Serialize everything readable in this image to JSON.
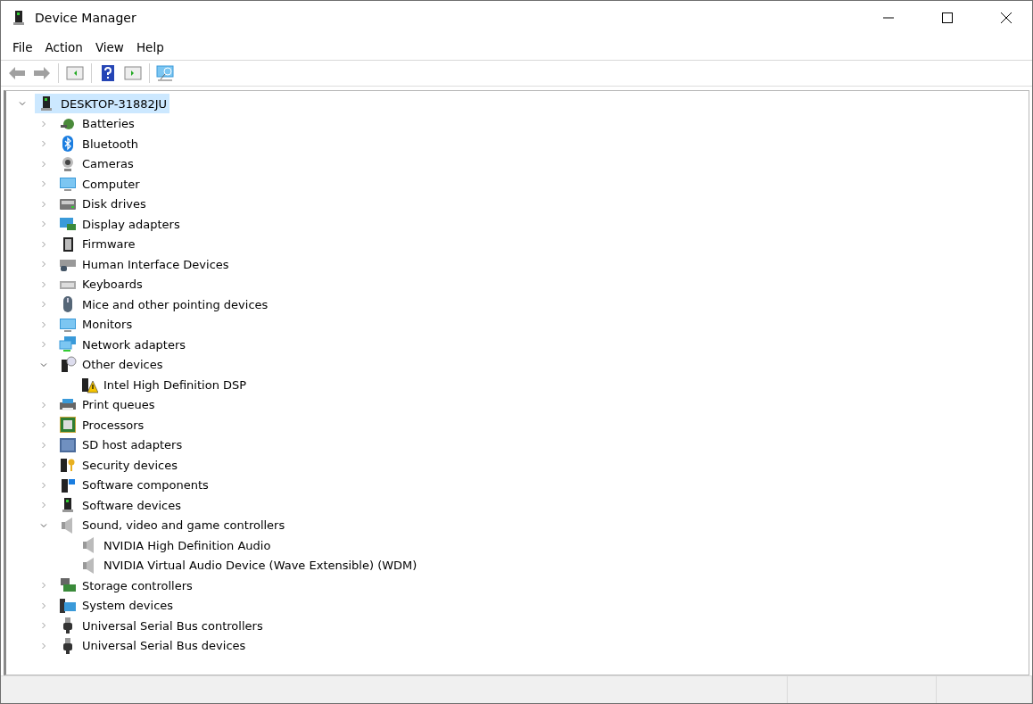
{
  "window": {
    "title": "Device Manager"
  },
  "menu": [
    "File",
    "Action",
    "View",
    "Help"
  ],
  "toolbar": [
    {
      "kind": "back",
      "disabled": true
    },
    {
      "kind": "forward",
      "disabled": true
    },
    {
      "kind": "separator"
    },
    {
      "kind": "console"
    },
    {
      "kind": "separator"
    },
    {
      "kind": "help"
    },
    {
      "kind": "pane"
    },
    {
      "kind": "separator"
    },
    {
      "kind": "scan"
    }
  ],
  "tree": {
    "label": "DESKTOP-31882JU",
    "expanded": true,
    "selected": true,
    "children": [
      {
        "label": "Batteries",
        "expanded": false
      },
      {
        "label": "Bluetooth",
        "expanded": false
      },
      {
        "label": "Cameras",
        "expanded": false
      },
      {
        "label": "Computer",
        "expanded": false
      },
      {
        "label": "Disk drives",
        "expanded": false
      },
      {
        "label": "Display adapters",
        "expanded": false
      },
      {
        "label": "Firmware",
        "expanded": false
      },
      {
        "label": "Human Interface Devices",
        "expanded": false
      },
      {
        "label": "Keyboards",
        "expanded": false
      },
      {
        "label": "Mice and other pointing devices",
        "expanded": false
      },
      {
        "label": "Monitors",
        "expanded": false
      },
      {
        "label": "Network adapters",
        "expanded": false
      },
      {
        "label": "Other devices",
        "expanded": true,
        "children": [
          {
            "label": "Intel High Definition DSP",
            "warning": true
          }
        ]
      },
      {
        "label": "Print queues",
        "expanded": false
      },
      {
        "label": "Processors",
        "expanded": false
      },
      {
        "label": "SD host adapters",
        "expanded": false
      },
      {
        "label": "Security devices",
        "expanded": false
      },
      {
        "label": "Software components",
        "expanded": false
      },
      {
        "label": "Software devices",
        "expanded": false
      },
      {
        "label": "Sound, video and game controllers",
        "expanded": true,
        "children": [
          {
            "label": "NVIDIA High Definition Audio",
            "warning": false
          },
          {
            "label": "NVIDIA Virtual Audio Device (Wave Extensible) (WDM)",
            "warning": false
          }
        ]
      },
      {
        "label": "Storage controllers",
        "expanded": false
      },
      {
        "label": "System devices",
        "expanded": false
      },
      {
        "label": "Universal Serial Bus controllers",
        "expanded": false
      },
      {
        "label": "Universal Serial Bus devices",
        "expanded": false
      }
    ]
  }
}
